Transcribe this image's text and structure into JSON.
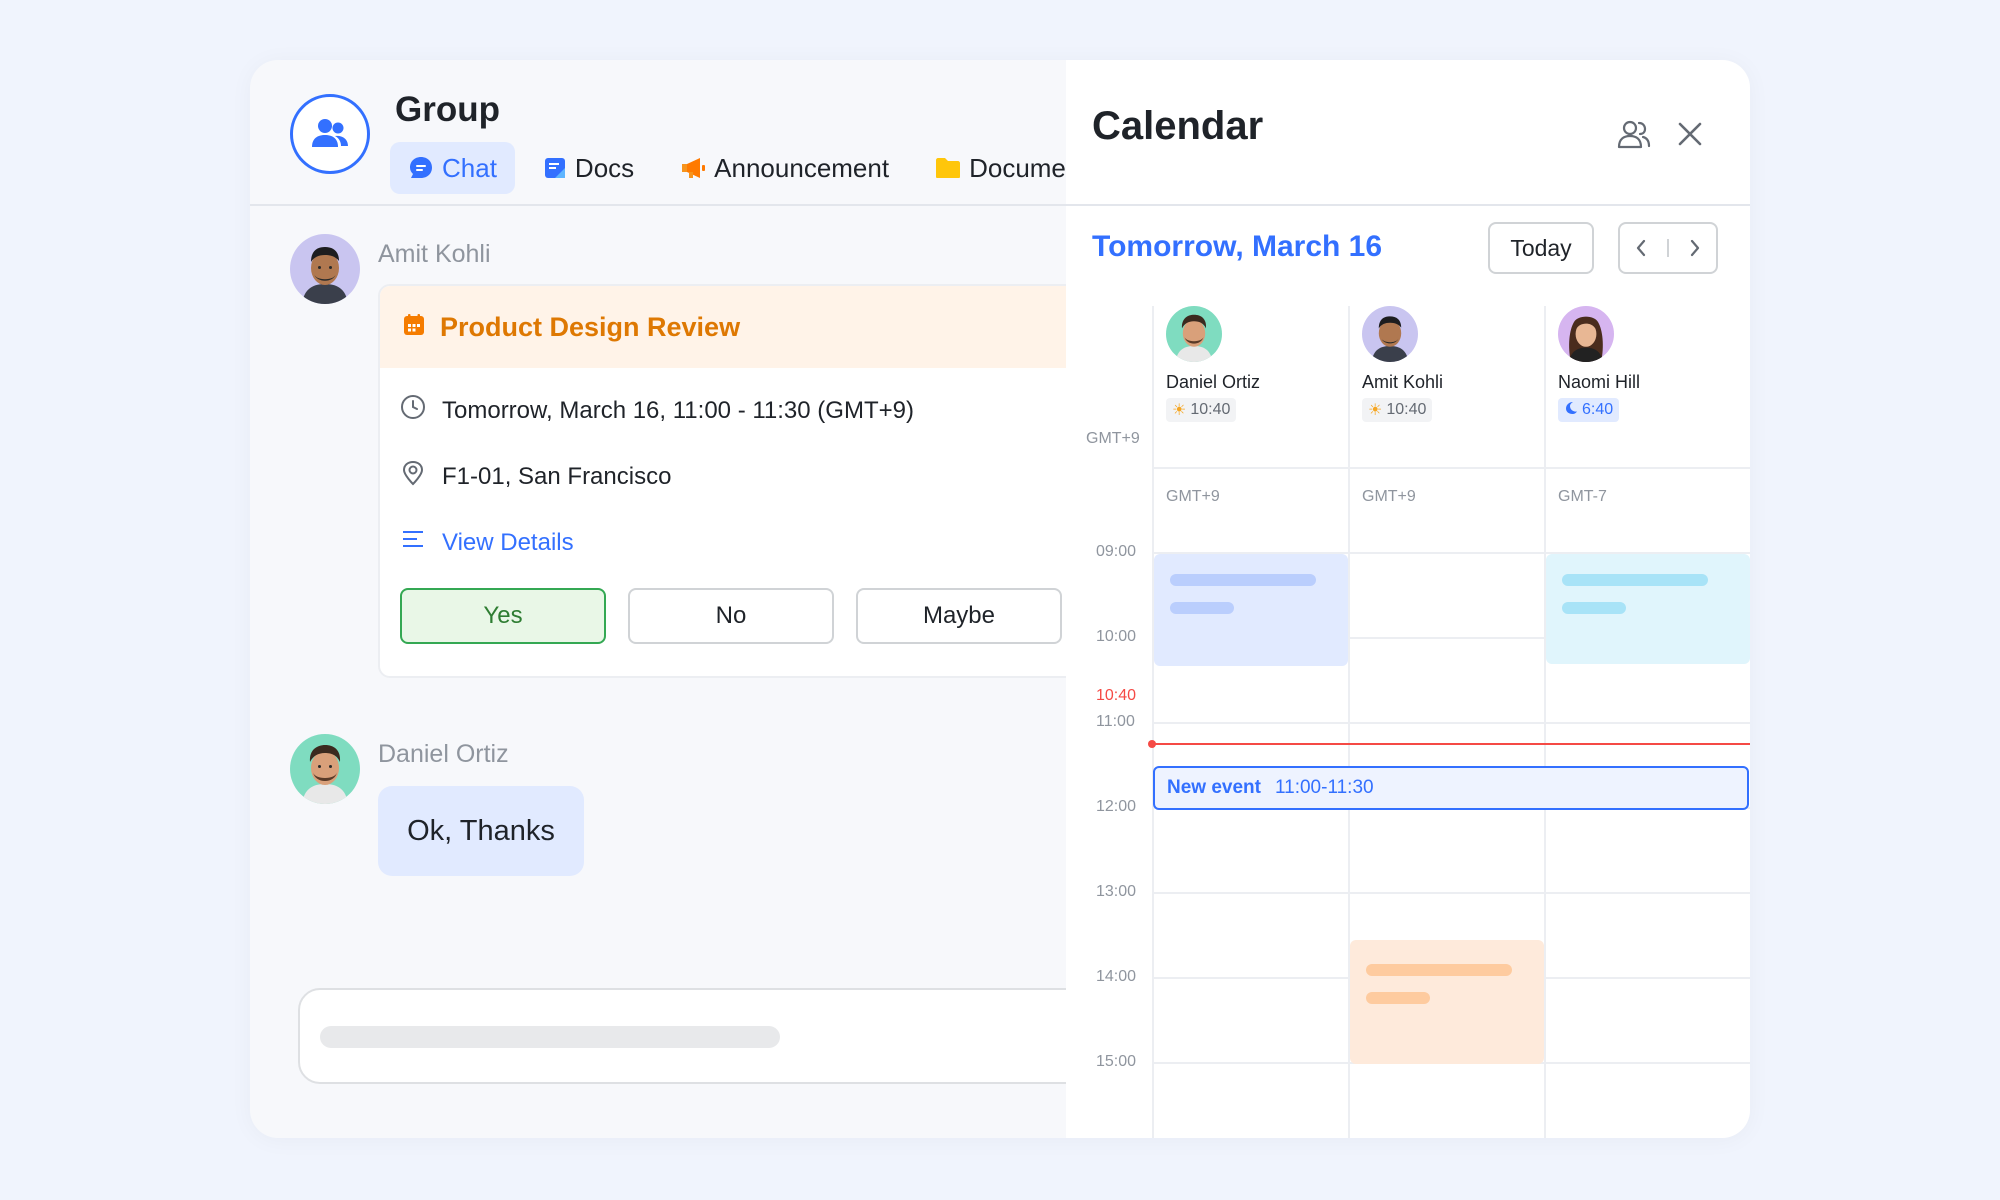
{
  "colors": {
    "accent": "#3370ff",
    "event_orange": "#de7802",
    "now_red": "#f54a45",
    "yes_green": "#34a853"
  },
  "chat": {
    "title": "Group",
    "group_icon": "group-people-icon",
    "tabs": [
      {
        "label": "Chat",
        "icon": "chat-bubble-icon",
        "active": true
      },
      {
        "label": "Docs",
        "icon": "docs-icon",
        "active": false
      },
      {
        "label": "Announcement",
        "icon": "megaphone-icon",
        "active": false
      },
      {
        "label": "Docume",
        "icon": "folder-icon",
        "active": false
      }
    ],
    "messages": {
      "first": {
        "sender": "Amit Kohli",
        "card": {
          "title": "Product Design Review",
          "time": "Tomorrow, March 16, 11:00 - 11:30 (GMT+9)",
          "location": "F1-01, San Francisco",
          "details_link": "View Details",
          "yes": "Yes",
          "no": "No",
          "maybe": "Maybe"
        }
      },
      "second": {
        "sender": "Daniel Ortiz",
        "text": "Ok, Thanks"
      }
    }
  },
  "calendar": {
    "title": "Calendar",
    "date_title": "Tomorrow, March 16",
    "today_label": "Today",
    "local_tz": "GMT+9",
    "people": [
      {
        "name": "Daniel Ortiz",
        "time": "10:40",
        "tz": "GMT+9",
        "period": "day"
      },
      {
        "name": "Amit Kohli",
        "time": "10:40",
        "tz": "GMT+9",
        "period": "day"
      },
      {
        "name": "Naomi Hill",
        "time": "6:40",
        "tz": "GMT-7",
        "period": "night"
      }
    ],
    "hours": [
      "09:00",
      "10:00",
      "11:00",
      "12:00",
      "13:00",
      "14:00",
      "15:00"
    ],
    "now_label": "10:40",
    "new_event": {
      "label": "New event",
      "time": "11:00-11:30"
    }
  }
}
